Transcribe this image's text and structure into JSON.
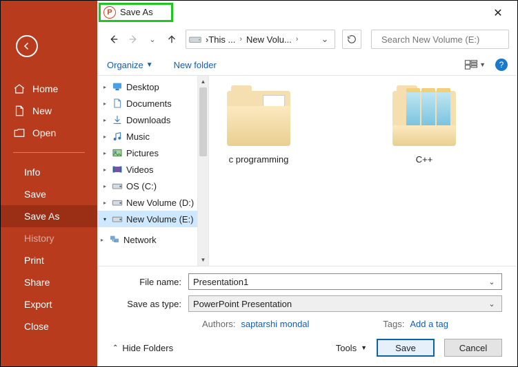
{
  "sidebar": {
    "top": [
      {
        "label": "Home",
        "icon": "home"
      },
      {
        "label": "New",
        "icon": "new"
      },
      {
        "label": "Open",
        "icon": "open"
      }
    ],
    "items": [
      {
        "label": "Info"
      },
      {
        "label": "Save"
      },
      {
        "label": "Save As",
        "selected": true
      },
      {
        "label": "History",
        "faded": true
      },
      {
        "label": "Print"
      },
      {
        "label": "Share"
      },
      {
        "label": "Export"
      },
      {
        "label": "Close"
      }
    ]
  },
  "dialog": {
    "title": "Save As",
    "breadcrumb": [
      "This ...",
      "New Volu..."
    ],
    "search_placeholder": "Search New Volume (E:)",
    "toolbar": {
      "organize": "Organize",
      "newfolder": "New folder"
    },
    "tree": [
      {
        "label": "Desktop",
        "icon": "desktop",
        "exp": "closed"
      },
      {
        "label": "Documents",
        "icon": "documents",
        "exp": "closed"
      },
      {
        "label": "Downloads",
        "icon": "downloads",
        "exp": "closed"
      },
      {
        "label": "Music",
        "icon": "music",
        "exp": "closed"
      },
      {
        "label": "Pictures",
        "icon": "pictures",
        "exp": "closed"
      },
      {
        "label": "Videos",
        "icon": "videos",
        "exp": "closed"
      },
      {
        "label": "OS (C:)",
        "icon": "drive",
        "exp": "closed"
      },
      {
        "label": "New Volume (D:)",
        "icon": "drive",
        "exp": "closed"
      },
      {
        "label": "New Volume (E:)",
        "icon": "drive",
        "exp": "closed",
        "selected": true
      },
      {
        "label": "Network",
        "icon": "network",
        "exp": "closed",
        "indent": 0
      }
    ],
    "folders": [
      {
        "label": "c programming",
        "kind": "docs"
      },
      {
        "label": "C++",
        "kind": "notes"
      }
    ],
    "filename_label": "File name:",
    "filename_value": "Presentation1",
    "type_label": "Save as type:",
    "type_value": "PowerPoint Presentation",
    "authors_label": "Authors:",
    "authors_value": "saptarshi mondal",
    "tags_label": "Tags:",
    "tags_value": "Add a tag",
    "hidefolders": "Hide Folders",
    "tools": "Tools",
    "save": "Save",
    "cancel": "Cancel"
  }
}
